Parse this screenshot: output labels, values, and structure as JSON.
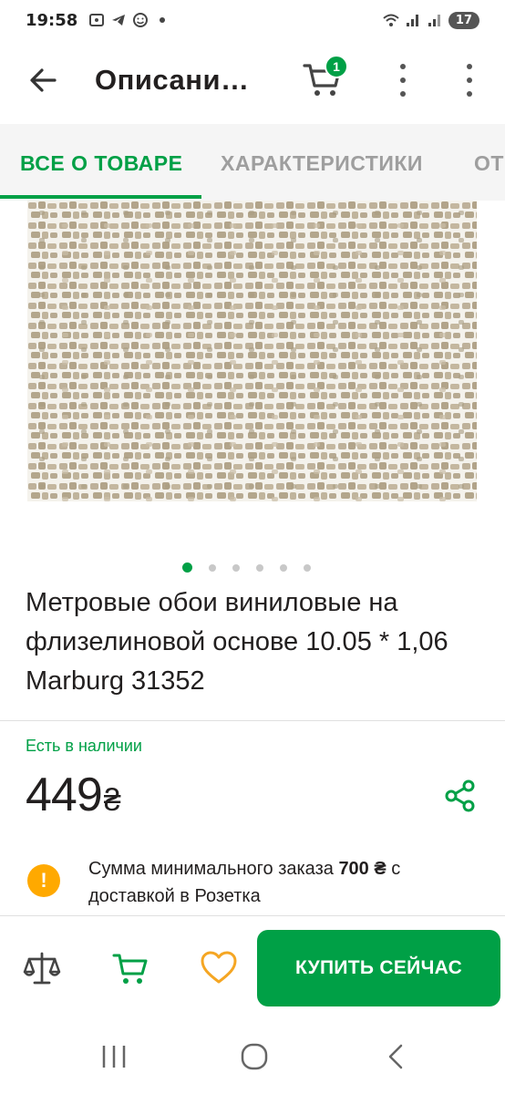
{
  "status_bar": {
    "time": "19:58",
    "battery": "17"
  },
  "header": {
    "title": "Описани…",
    "cart_count": "1"
  },
  "tabs": [
    {
      "label": "ВСЕ О ТОВАРЕ"
    },
    {
      "label": "ХАРАКТЕРИСТИКИ"
    },
    {
      "label": "ОТ"
    }
  ],
  "product": {
    "title": "Метровые обои виниловые на флизелиновой основе 10.05 * 1,06 Marburg 31352",
    "availability": "Есть в наличии",
    "price": "449",
    "currency": "₴",
    "image_count": 6,
    "current_image_index": 1
  },
  "min_order": {
    "text_before": "Сумма минимального заказа ",
    "amount": "700 ₴",
    "text_after": " с доставкой в Розетка"
  },
  "actions": {
    "buy_label": "КУПИТЬ СЕЙЧАС"
  },
  "colors": {
    "accent": "#00a046",
    "warning": "#ffa900",
    "text": "#221f1f"
  }
}
